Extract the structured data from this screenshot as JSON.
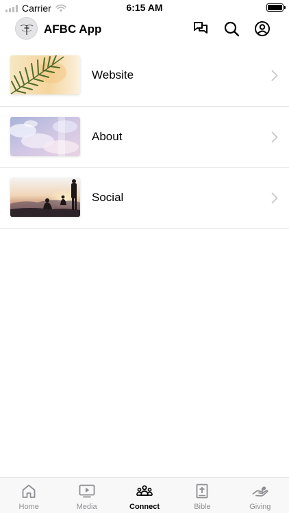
{
  "status_bar": {
    "carrier": "Carrier",
    "time": "6:15 AM"
  },
  "header": {
    "app_title": "AFBC App",
    "icons": [
      "chat-icon",
      "search-icon",
      "profile-icon"
    ]
  },
  "list": {
    "items": [
      {
        "label": "Website",
        "thumb": "palm-leaf-image"
      },
      {
        "label": "About",
        "thumb": "clouds-sky-image"
      },
      {
        "label": "Social",
        "thumb": "sunset-people-image"
      }
    ]
  },
  "tab_bar": {
    "tabs": [
      {
        "label": "Home",
        "icon": "home-icon",
        "active": false
      },
      {
        "label": "Media",
        "icon": "play-tv-icon",
        "active": false
      },
      {
        "label": "Connect",
        "icon": "people-group-icon",
        "active": true
      },
      {
        "label": "Bible",
        "icon": "bible-book-icon",
        "active": false
      },
      {
        "label": "Giving",
        "icon": "giving-hand-icon",
        "active": false
      }
    ]
  },
  "colors": {
    "active_tab": "#000000",
    "inactive_tab": "#8e8e93",
    "divider": "#e3e3e3",
    "chevron": "#c7c7cc"
  }
}
